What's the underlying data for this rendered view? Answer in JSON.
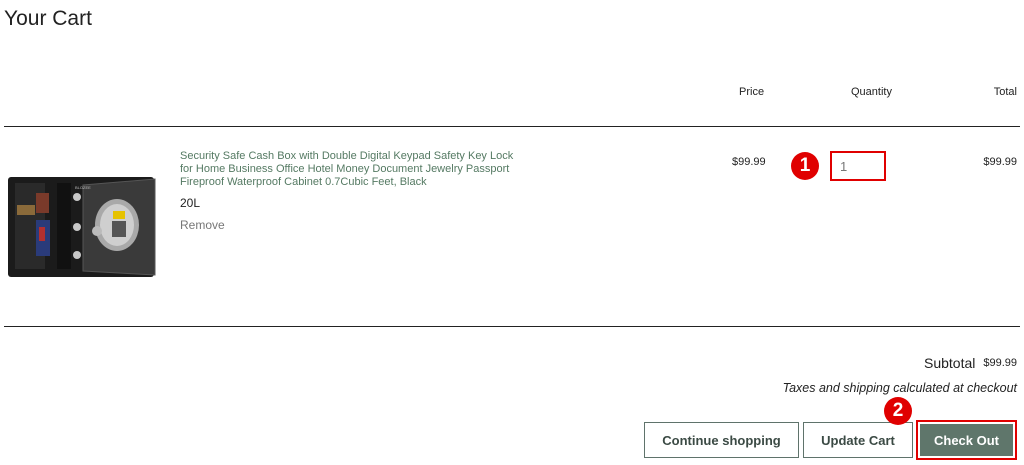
{
  "cart": {
    "title": "Your Cart",
    "columns": {
      "price": "Price",
      "quantity": "Quantity",
      "total": "Total"
    },
    "item": {
      "name": "Security Safe Cash Box with Double Digital Keypad Safety Key Lock for Home Business Office Hotel Money Document Jewelry Passport Fireproof Waterproof Cabinet 0.7Cubic Feet, Black",
      "variant": "20L",
      "remove_label": "Remove",
      "price": "$99.99",
      "quantity": "1",
      "total": "$99.99",
      "image_icon": "safe-box-image"
    },
    "subtotal_label": "Subtotal",
    "subtotal_value": "$99.99",
    "tax_note": "Taxes and shipping calculated at checkout"
  },
  "buttons": {
    "continue_label": "Continue shopping",
    "update_label": "Update Cart",
    "checkout_label": "Check Out"
  },
  "annotations": {
    "marker_1": "1",
    "marker_2": "2"
  },
  "colors": {
    "accent": "#5f766b",
    "product_link": "#557a63",
    "highlight": "#e00000"
  }
}
